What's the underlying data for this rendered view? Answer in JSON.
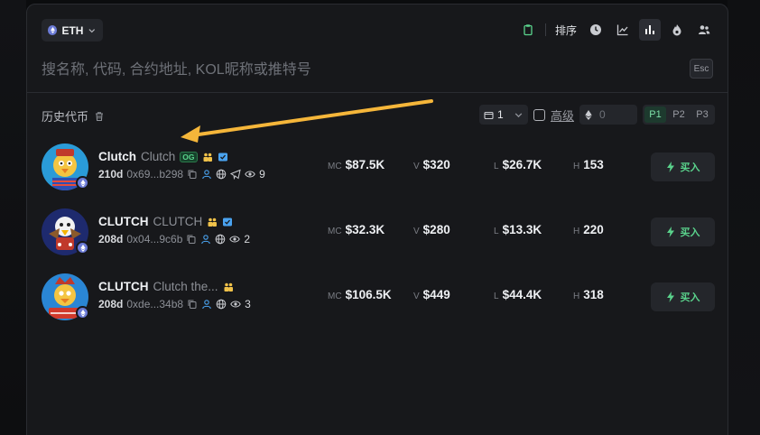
{
  "chain": {
    "label": "ETH",
    "icon": "ethereum-icon"
  },
  "toolbar": {
    "sort_label": "排序",
    "icons": [
      "clipboard-icon",
      "clock-icon",
      "line-chart-icon",
      "bar-chart-icon",
      "flame-icon",
      "users-icon"
    ],
    "active": "bar-chart-icon"
  },
  "search": {
    "placeholder": "搜名称, 代码, 合约地址, KOL昵称或推特号",
    "value": "",
    "esc_label": "Esc"
  },
  "history": {
    "label": "历史代币",
    "icon": "trash-icon"
  },
  "filters": {
    "page_value": "1",
    "advanced_label": "高级",
    "eth_amount_placeholder": "0",
    "presets": [
      "P1",
      "P2",
      "P3"
    ],
    "active_preset": "P1"
  },
  "tokens": [
    {
      "symbol": "Clutch",
      "name": "Clutch",
      "og_tag": "OG",
      "age": "210d",
      "address": "0x69...b298",
      "watchers": "9",
      "mc_label": "MC",
      "mc": "$87.5K",
      "v_label": "V",
      "v": "$320",
      "l_label": "L",
      "l": "$26.7K",
      "h_label": "H",
      "h": "153",
      "buy_label": "买入"
    },
    {
      "symbol": "CLUTCH",
      "name": "CLUTCH",
      "og_tag": "",
      "age": "208d",
      "address": "0x04...9c6b",
      "watchers": "2",
      "mc_label": "MC",
      "mc": "$32.3K",
      "v_label": "V",
      "v": "$280",
      "l_label": "L",
      "l": "$13.3K",
      "h_label": "H",
      "h": "220",
      "buy_label": "买入"
    },
    {
      "symbol": "CLUTCH",
      "name": "Clutch the...",
      "og_tag": "",
      "age": "208d",
      "address": "0xde...34b8",
      "watchers": "3",
      "mc_label": "MC",
      "mc": "$106.5K",
      "v_label": "V",
      "v": "$449",
      "l_label": "L",
      "l": "$44.4K",
      "h_label": "H",
      "h": "318",
      "buy_label": "买入"
    }
  ],
  "colors": {
    "accent_green": "#5ad38c",
    "arrow": "#f5b63a",
    "eth_blue": "#6b7bd6"
  }
}
